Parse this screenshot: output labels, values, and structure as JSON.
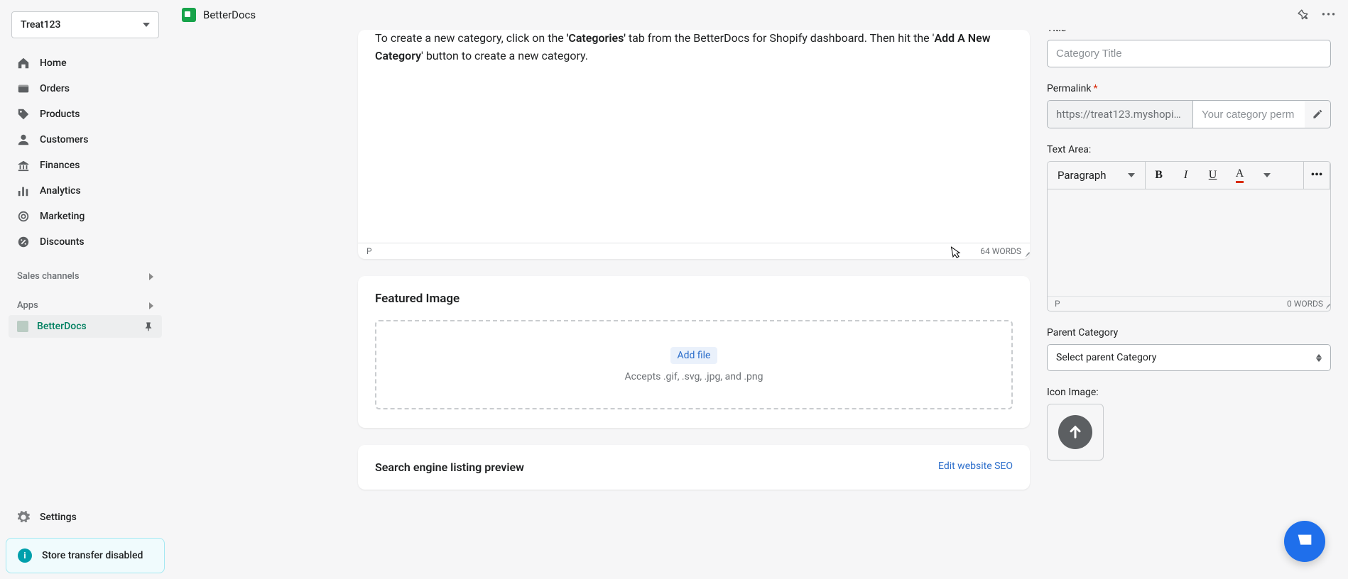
{
  "store": {
    "name": "Treat123"
  },
  "header": {
    "app_name": "BetterDocs"
  },
  "sidebar": {
    "items": [
      {
        "label": "Home"
      },
      {
        "label": "Orders"
      },
      {
        "label": "Products"
      },
      {
        "label": "Customers"
      },
      {
        "label": "Finances"
      },
      {
        "label": "Analytics"
      },
      {
        "label": "Marketing"
      },
      {
        "label": "Discounts"
      }
    ],
    "sections": {
      "sales": "Sales channels",
      "apps": "Apps"
    },
    "app_item": "BetterDocs",
    "settings": "Settings",
    "banner": "Store transfer disabled"
  },
  "editor": {
    "para1_a": "To create a new category, click on the ",
    "para1_b": "'Categories'",
    "para1_c": " tab from the BetterDocs for Shopify dashboard. Then hit the '",
    "para1_d": "Add A New Category",
    "para1_e": "' button to create a new category.",
    "status_left": "P",
    "status_right": "64 WORDS"
  },
  "featured": {
    "title": "Featured Image",
    "add_file": "Add file",
    "accepts": "Accepts .gif, .svg, .jpg, and .png"
  },
  "seo": {
    "title": "Search engine listing preview",
    "link": "Edit website SEO"
  },
  "form": {
    "title_label": "Title",
    "title_placeholder": "Category Title",
    "permalink_label": "Permalink",
    "permalink_prefix": "https://treat123.myshopify....",
    "permalink_placeholder": "Your category perm",
    "textarea_label": "Text Area:",
    "paragraph": "Paragraph",
    "rte_status_left": "P",
    "rte_status_right": "0 WORDS",
    "parent_label": "Parent Category",
    "parent_placeholder": "Select parent Category",
    "icon_label": "Icon Image:"
  }
}
